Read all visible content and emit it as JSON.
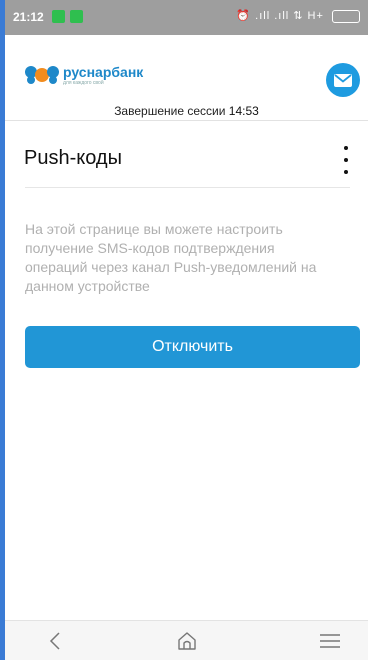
{
  "statusbar": {
    "time": "21:12",
    "right_text": "⏰ .ıll .ıll ⇅ H+"
  },
  "brand": {
    "name": "руснарбанк",
    "tagline": "для каждого свой"
  },
  "session": {
    "label": "Завершение сессии",
    "time": "14:53"
  },
  "page": {
    "title": "Push-коды",
    "description": "На этой странице вы можете настроить получение SMS-кодов подтверждения операций через канал Push-уведомлений на данном устройстве",
    "disable_button": "Отключить"
  },
  "colors": {
    "accent": "#2196d6",
    "brand": "#1e88c9",
    "statusbar": "#9e9e9e"
  },
  "icons": {
    "mail": "mail-icon",
    "menu": "kebab-menu-icon",
    "back": "back-icon",
    "home": "home-icon",
    "recents": "menu-lines-icon"
  }
}
